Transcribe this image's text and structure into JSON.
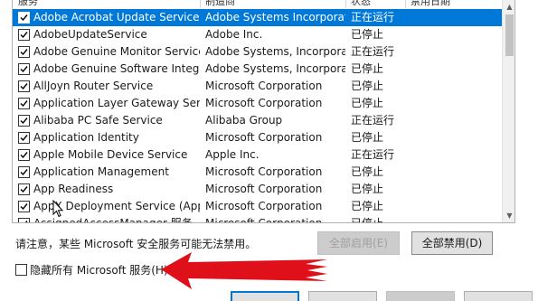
{
  "header": {
    "columns": [
      "服务",
      "制造商",
      "状态",
      "禁用日期"
    ]
  },
  "services": [
    {
      "name": "Adobe Acrobat Update Service",
      "maker": "Adobe Systems Incorporat",
      "status": "正在运行",
      "checked": true,
      "selected": true
    },
    {
      "name": "AdobeUpdateService",
      "maker": "Adobe Inc.",
      "status": "已停止",
      "checked": true
    },
    {
      "name": "Adobe Genuine Monitor Service",
      "maker": "Adobe Systems, Incorpora",
      "status": "正在运行",
      "checked": true
    },
    {
      "name": "Adobe Genuine Software Integrit...",
      "maker": "Adobe Systems, Incorpora",
      "status": "已停止",
      "checked": true
    },
    {
      "name": "AllJoyn Router Service",
      "maker": "Microsoft Corporation",
      "status": "已停止",
      "checked": true
    },
    {
      "name": "Application Layer Gateway Service",
      "maker": "Microsoft Corporation",
      "status": "已停止",
      "checked": true
    },
    {
      "name": "Alibaba PC Safe Service",
      "maker": "Alibaba Group",
      "status": "正在运行",
      "checked": true
    },
    {
      "name": "Application Identity",
      "maker": "Microsoft Corporation",
      "status": "已停止",
      "checked": true
    },
    {
      "name": "Apple Mobile Device Service",
      "maker": "Apple Inc.",
      "status": "正在运行",
      "checked": true
    },
    {
      "name": "Application Management",
      "maker": "Microsoft Corporation",
      "status": "已停止",
      "checked": true
    },
    {
      "name": "App Readiness",
      "maker": "Microsoft Corporation",
      "status": "已停止",
      "checked": true
    },
    {
      "name": "AppX Deployment Service (AppX...",
      "maker": "Microsoft Corporation",
      "status": "已停止",
      "checked": true
    },
    {
      "name": "AssignedAccessManager 服务",
      "maker": "Microsoft Corporation",
      "status": "已停止",
      "checked": true
    }
  ],
  "note": "请注意，某些 Microsoft 安全服务可能无法禁用。",
  "buttons": {
    "enable_all": "全部启用(E)",
    "disable_all": "全部禁用(D)"
  },
  "hide_microsoft": {
    "label": "隐藏所有 Microsoft 服务(H)",
    "checked": false
  },
  "colors": {
    "selection": "#0078d7",
    "annotation_arrow": "#e0101a"
  }
}
